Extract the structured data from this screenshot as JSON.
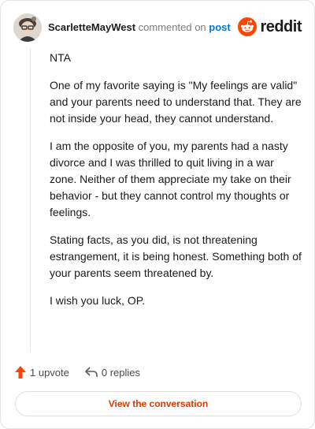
{
  "header": {
    "username": "ScarletteMayWest",
    "action_text": "commented on",
    "post_link": "post",
    "brand": "reddit"
  },
  "comment": {
    "paragraphs": [
      "NTA",
      "One of my favorite saying is \"My feelings are valid\" and your parents need to understand that. They are not inside your head, they cannot understand.",
      "I am the opposite of you, my parents had a nasty divorce and I was thrilled to quit living in a war zone. Neither of them appreciate my take on their behavior - but they cannot control my thoughts or feelings.",
      "Stating facts, as you did, is not threatening estrangement, it is being honest. Something both of your parents seem threatened by.",
      "I wish you luck, OP."
    ]
  },
  "actions": {
    "upvotes": "1 upvote",
    "replies": "0 replies"
  },
  "cta": {
    "label": "View the conversation"
  },
  "colors": {
    "brand_orange": "#ff4500",
    "upvote": "#ff4500",
    "link_blue": "#0079d3",
    "cta_text": "#d93a00"
  }
}
